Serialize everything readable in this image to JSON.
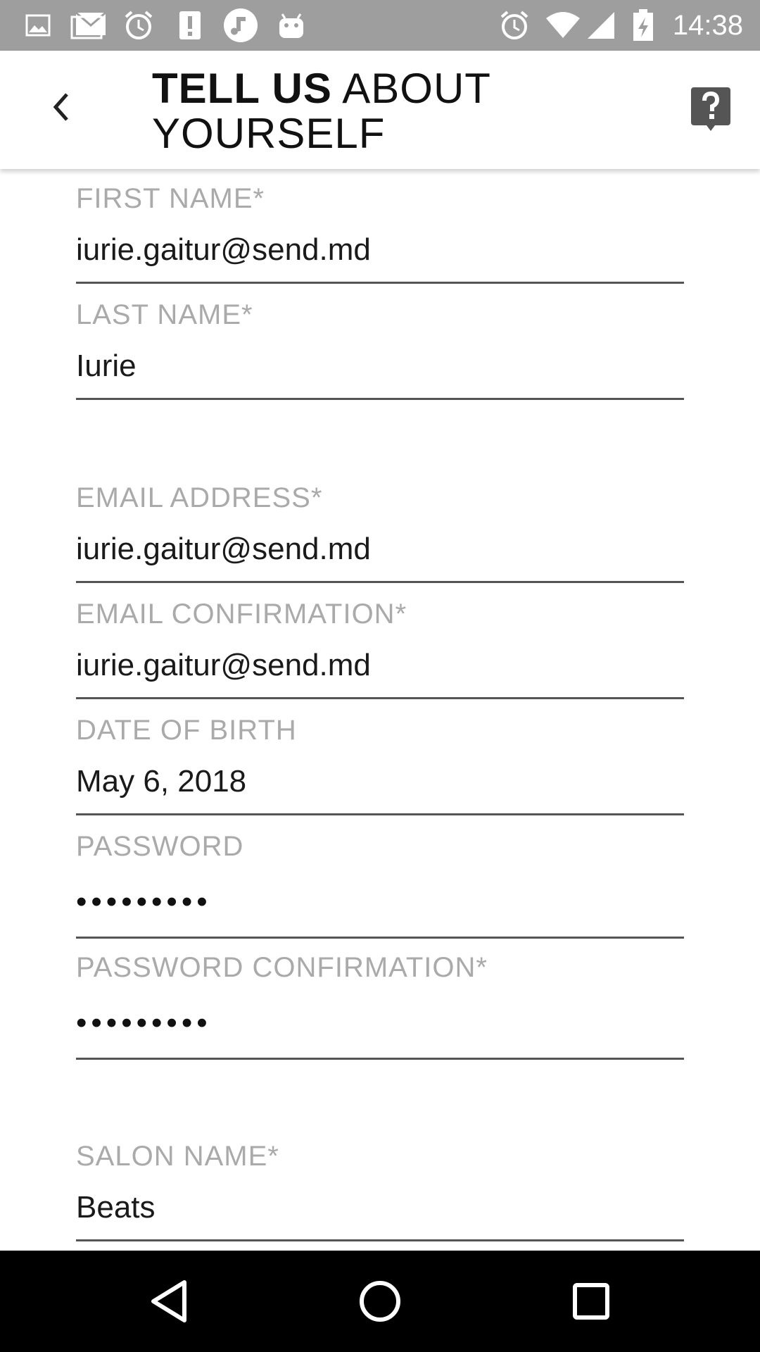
{
  "status_bar": {
    "time": "14:38",
    "left_icons": [
      "image-icon",
      "mail-icon",
      "alarm-icon",
      "alert-icon",
      "music-icon",
      "android-icon"
    ],
    "right_icons": [
      "alarm-icon",
      "wifi-icon",
      "signal-icon",
      "battery-icon"
    ]
  },
  "header": {
    "title_bold": "TELL US",
    "title_light_1": "ABOUT",
    "title_light_2": "YOURSELF",
    "back_icon": "chevron-left-icon",
    "help_icon": "help-icon"
  },
  "form": {
    "first_name": {
      "label": "FIRST NAME*",
      "value": "iurie.gaitur@send.md"
    },
    "last_name": {
      "label": "LAST NAME*",
      "value": "Iurie"
    },
    "email": {
      "label": "EMAIL ADDRESS*",
      "value": "iurie.gaitur@send.md"
    },
    "email_confirmation": {
      "label": "EMAIL CONFIRMATION*",
      "value": "iurie.gaitur@send.md"
    },
    "date_of_birth": {
      "label": "DATE OF BIRTH",
      "value": "May 6, 2018"
    },
    "password": {
      "label": "PASSWORD",
      "value": "•••••••••"
    },
    "password_confirmation": {
      "label": "PASSWORD CONFIRMATION*",
      "value": "•••••••••"
    },
    "salon_name": {
      "label": "SALON NAME*",
      "value": "Beats"
    }
  },
  "nav_bar": {
    "back": "nav-back-icon",
    "home": "nav-home-icon",
    "recents": "nav-recents-icon"
  },
  "colors": {
    "status_bar": "#9e9e9e",
    "label": "#aaaaaa",
    "underline": "#555555",
    "nav_bar": "#000000"
  }
}
